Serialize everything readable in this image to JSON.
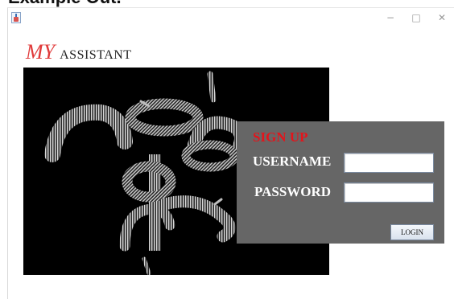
{
  "header_fragment": "Example Out...",
  "titlebar": {
    "minimize_icon": "−",
    "maximize_icon": "□",
    "close_icon": "✕"
  },
  "brand": {
    "prefix": "MY",
    "suffix": "ASSISTANT",
    "prefix_color": "#e03a3a"
  },
  "signup": {
    "title": "SIGN UP",
    "title_color": "#e4141b",
    "username_label": "USERNAME",
    "password_label": "PASSWORD",
    "username_value": "",
    "password_value": "",
    "login_label": "LOGIN",
    "panel_color": "#666666"
  },
  "icons": {
    "app": "java-app-icon",
    "hero": "abstract-spiral-artwork"
  }
}
